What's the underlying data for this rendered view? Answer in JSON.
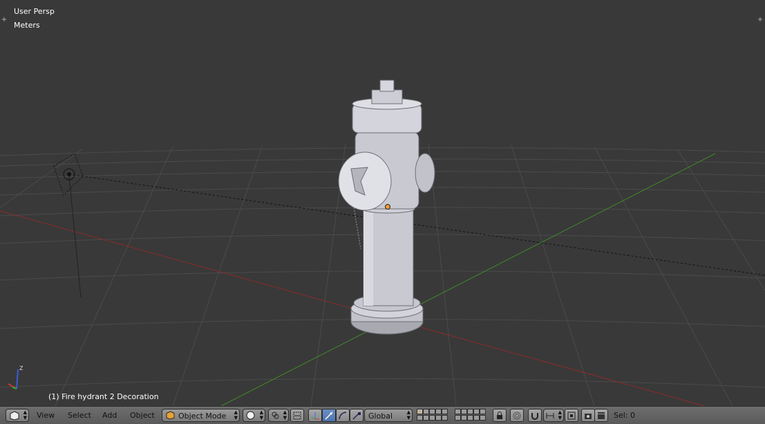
{
  "viewport": {
    "view_name": "User Persp",
    "units": "Meters",
    "object_label": "(1) Fire hydrant 2 Decoration",
    "axis_label": "Z"
  },
  "header": {
    "menus": [
      "View",
      "Select",
      "Add",
      "Object"
    ],
    "mode": "Object Mode",
    "orientation": "Global",
    "selection": "Sel: 0"
  },
  "colors": {
    "background": "#393939",
    "grid_line": "#4a4a4a",
    "x_axis": "#8b2b2b",
    "y_axis": "#3f8a2a",
    "header": "#666666",
    "object": "#c9c9d2",
    "active_button": "#5680c2"
  },
  "icons": [
    "editor-type-icon",
    "object-mode-cube-icon",
    "shading-sphere-icon",
    "pivot-icon",
    "snap-icon",
    "manipulator-translate-icon",
    "manipulator-rotate-icon",
    "manipulator-scale-icon",
    "layer-grid-icon",
    "lock-icon",
    "proportional-icon",
    "snap-magnet-icon",
    "render-icon",
    "camera-icon"
  ]
}
